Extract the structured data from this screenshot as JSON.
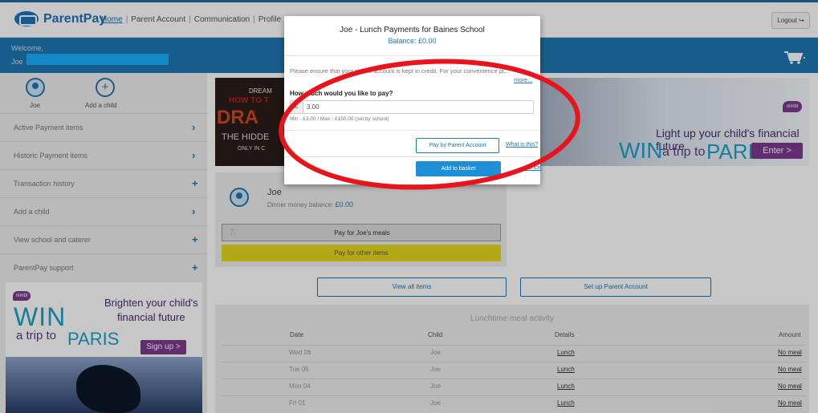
{
  "header": {
    "logo_text": "ParentPay",
    "nav": [
      {
        "label": "Home"
      },
      {
        "label": "Parent Account"
      },
      {
        "label": "Communication"
      },
      {
        "label": "Profile"
      }
    ],
    "logout_label": "Logout",
    "welcome_label": "Welcome,",
    "user_first_name": "Joe",
    "cart_icon": "shopping-cart-icon"
  },
  "sidebar": {
    "children": [
      {
        "name": "Joe",
        "icon": "child-avatar-icon"
      },
      {
        "name": "Add a child",
        "icon": "plus-icon"
      }
    ],
    "items": [
      {
        "label": "Active Payment items",
        "icon": "chevron-right-icon",
        "glyph": "›"
      },
      {
        "label": "Historic Payment items",
        "icon": "chevron-right-icon",
        "glyph": "›"
      },
      {
        "label": "Transaction history",
        "icon": "plus-icon",
        "glyph": "+"
      },
      {
        "label": "Add a child",
        "icon": "chevron-right-icon",
        "glyph": "›"
      },
      {
        "label": "View school and caterer",
        "icon": "plus-icon",
        "glyph": "+"
      },
      {
        "label": "ParentPay support",
        "icon": "plus-icon",
        "glyph": "+"
      }
    ],
    "ad": {
      "brand": "nimbl",
      "line1": "Brighten your child's",
      "line2": "financial future",
      "win": "WIN",
      "trip": "a trip to",
      "paris": "PARIS",
      "cta": "Sign up >"
    }
  },
  "banner": {
    "left_line1": "DREAM",
    "left_line2": "HOW TO T",
    "left_line3": "DRA",
    "left_line4": "THE HIDDE",
    "left_line5": "ONLY IN C",
    "brand": "nimbl",
    "headline": "Light up your child's financial future",
    "win": "WIN",
    "trip": "a trip to",
    "paris": "PARIS",
    "cta": "Enter >"
  },
  "child_card": {
    "name": "Joe",
    "balance_label": "Dinner money balance:",
    "balance_value": "£0.00",
    "meals_button": "Pay for Joe's meals",
    "other_button": "Pay for other items"
  },
  "actions": {
    "view_all": "View all items",
    "setup_account": "Set up Parent Account"
  },
  "activity": {
    "title": "Lunchtime meal activity",
    "columns": [
      "Date",
      "Child",
      "Details",
      "Amount"
    ],
    "rows": [
      {
        "date": "Wed 06",
        "child": "Joe",
        "details": "Lunch",
        "amount": "No meal"
      },
      {
        "date": "Tue 05",
        "child": "Joe",
        "details": "Lunch",
        "amount": "No meal"
      },
      {
        "date": "Mon 04",
        "child": "Joe",
        "details": "Lunch",
        "amount": "No meal"
      },
      {
        "date": "Fri 01",
        "child": "Joe",
        "details": "Lunch",
        "amount": "No meal"
      }
    ]
  },
  "modal": {
    "title": "Joe - Lunch Payments for Baines School",
    "balance_label": "Balance:",
    "balance_value": "£0.00",
    "info": "Please ensure that your child's account is kept in credit. For your convenience pl...",
    "more": "more...",
    "question": "How much would you like to pay?",
    "currency": "£",
    "amount_value": "3.00",
    "minmax": "Min - £3.00 / Max - £150.00 (set by school)",
    "pay_by_account": "Pay by Parent Account",
    "what_is_this": "What is this?",
    "add_to_basket": "Add to basket",
    "cancel": "Cancel"
  },
  "annotation": {
    "color": "#e8131b"
  }
}
